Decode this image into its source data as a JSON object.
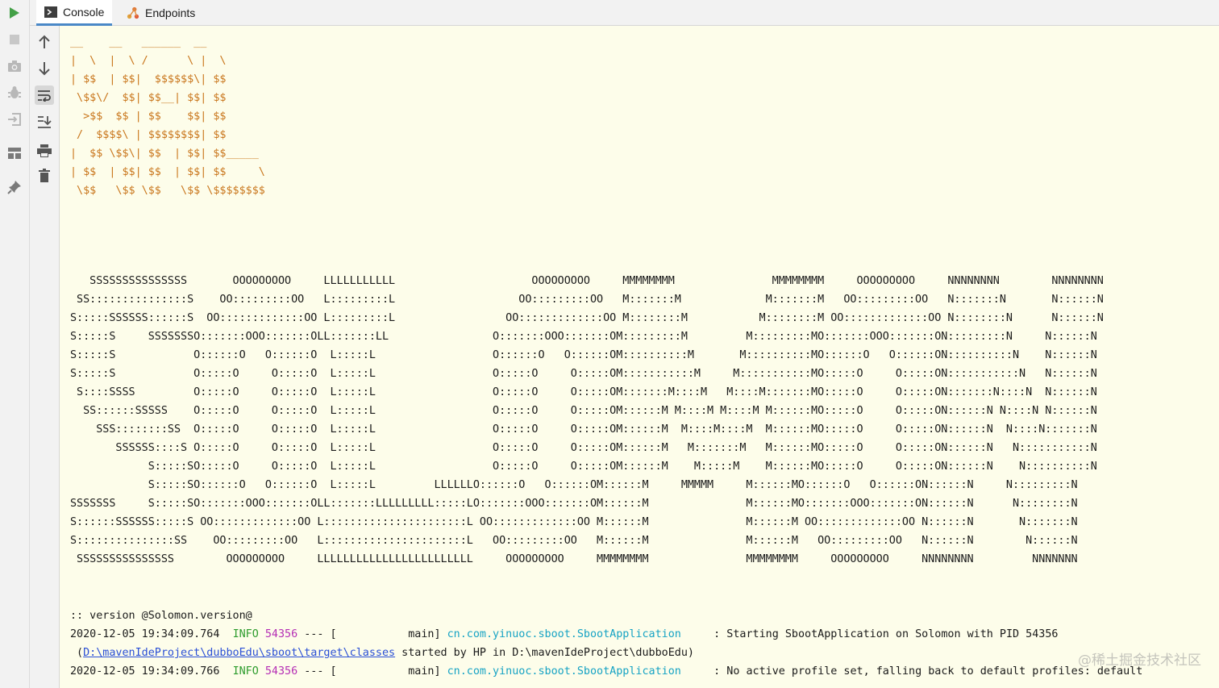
{
  "tabs": [
    {
      "label": "Console",
      "icon": "console-icon",
      "active": true
    },
    {
      "label": "Endpoints",
      "icon": "endpoints-icon",
      "active": false
    }
  ],
  "left_strip_icons": [
    "run-icon",
    "stop-icon",
    "camera-icon",
    "debug-icon",
    "exit-icon",
    "layout-icon",
    "pin-icon"
  ],
  "console_toolbar_icons": [
    "arrow-up-icon",
    "arrow-down-icon",
    "soft-wrap-icon",
    "scroll-to-end-icon",
    "print-icon",
    "trash-icon"
  ],
  "colors": {
    "banner": "#c9761c",
    "info": "#2e9c2e",
    "pid": "#b52eb5",
    "logger": "#16a3c4",
    "link": "#2a4fd6",
    "background": "#fdfdea"
  },
  "banner_small": [
    "__    __   ______  __",
    "|  \\  |  \\ /      \\ |  \\",
    "| $$  | $$|  $$$$$$\\| $$",
    " \\$$\\/  $$| $$__| $$| $$",
    "  >$$  $$ | $$    $$| $$",
    " /  $$$$\\ | $$$$$$$$| $$",
    "|  $$ \\$$\\| $$  | $$| $$_____",
    "| $$  | $$| $$  | $$| $$     \\",
    " \\$$   \\$$ \\$$   \\$$ \\$$$$$$$$"
  ],
  "banner_large": [
    "   SSSSSSSSSSSSSSS       OOOOOOOOO     LLLLLLLLLLL                     OOOOOOOOO     MMMMMMMM               MMMMMMMM     OOOOOOOOO     NNNNNNNN        NNNNNNNN",
    " SS:::::::::::::::S    OO:::::::::OO   L:::::::::L                   OO:::::::::OO   M:::::::M             M:::::::M   OO:::::::::OO   N:::::::N       N::::::N",
    "S:::::SSSSSS::::::S  OO:::::::::::::OO L:::::::::L                 OO:::::::::::::OO M::::::::M           M::::::::M OO:::::::::::::OO N::::::::N      N::::::N",
    "S:::::S     SSSSSSSO:::::::OOO:::::::OLL:::::::LL                O:::::::OOO:::::::OM:::::::::M         M:::::::::MO:::::::OOO:::::::ON:::::::::N     N::::::N",
    "S:::::S            O::::::O   O::::::O  L:::::L                  O::::::O   O::::::OM::::::::::M       M::::::::::MO::::::O   O::::::ON::::::::::N    N::::::N",
    "S:::::S            O:::::O     O:::::O  L:::::L                  O:::::O     O:::::OM:::::::::::M     M:::::::::::MO:::::O     O:::::ON:::::::::::N   N::::::N",
    " S::::SSSS         O:::::O     O:::::O  L:::::L                  O:::::O     O:::::OM:::::::M::::M   M::::M:::::::MO:::::O     O:::::ON:::::::N::::N  N::::::N",
    "  SS::::::SSSSS    O:::::O     O:::::O  L:::::L                  O:::::O     O:::::OM::::::M M::::M M::::M M::::::MO:::::O     O:::::ON::::::N N::::N N::::::N",
    "    SSS::::::::SS  O:::::O     O:::::O  L:::::L                  O:::::O     O:::::OM::::::M  M::::M::::M  M::::::MO:::::O     O:::::ON::::::N  N::::N:::::::N",
    "       SSSSSS::::S O:::::O     O:::::O  L:::::L                  O:::::O     O:::::OM::::::M   M:::::::M   M::::::MO:::::O     O:::::ON::::::N   N:::::::::::N",
    "            S:::::SO:::::O     O:::::O  L:::::L                  O:::::O     O:::::OM::::::M    M:::::M    M::::::MO:::::O     O:::::ON::::::N    N::::::::::N",
    "            S:::::SO::::::O   O::::::O  L:::::L         LLLLLLO::::::O   O::::::OM::::::M     MMMMM     M::::::MO::::::O   O::::::ON::::::N     N:::::::::N",
    "SSSSSSS     S:::::SO:::::::OOO:::::::OLL:::::::LLLLLLLLL:::::LO:::::::OOO:::::::OM::::::M               M::::::MO:::::::OOO:::::::ON::::::N      N::::::::N",
    "S::::::SSSSSS:::::S OO:::::::::::::OO L::::::::::::::::::::::L OO:::::::::::::OO M::::::M               M::::::M OO:::::::::::::OO N::::::N       N:::::::N",
    "S:::::::::::::::SS    OO:::::::::OO   L::::::::::::::::::::::L   OO:::::::::OO   M::::::M               M::::::M   OO:::::::::OO   N::::::N        N::::::N",
    " SSSSSSSSSSSSSSS        OOOOOOOOO     LLLLLLLLLLLLLLLLLLLLLLLL     OOOOOOOOO     MMMMMMMM               MMMMMMMM     OOOOOOOOO     NNNNNNNN         NNNNNNN"
  ],
  "log": {
    "version_line": ":: version @Solomon.version@",
    "line1": {
      "timestamp": "2020-12-05 19:34:09.764",
      "level": "INFO",
      "pid": "54356",
      "sep": "--- [",
      "thread": "           main]",
      "logger": "cn.com.yinuoc.sboot.SbootApplication",
      "message": "     : Starting SbootApplication on Solomon with PID 54356"
    },
    "line2": {
      "prefix": " (",
      "link": "D:\\mavenIdeProject\\dubboEdu\\sboot\\target\\classes",
      "suffix": " started by HP in D:\\mavenIdeProject\\dubboEdu)"
    },
    "line3": {
      "timestamp": "2020-12-05 19:34:09.766",
      "level": "INFO",
      "pid": "54356",
      "sep": "--- [",
      "thread": "           main]",
      "logger": "cn.com.yinuoc.sboot.SbootApplication",
      "message": "     : No active profile set, falling back to default profiles: default"
    }
  },
  "watermark": "@稀土掘金技术社区"
}
